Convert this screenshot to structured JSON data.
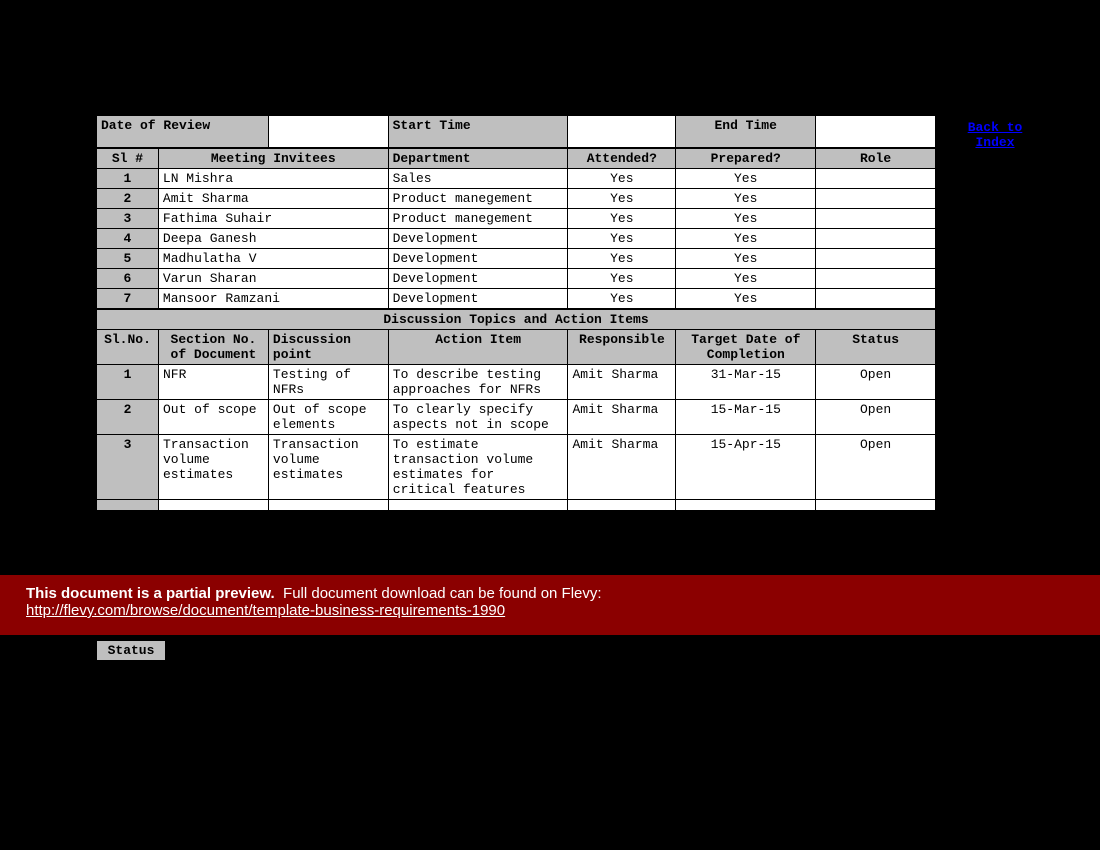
{
  "review": {
    "date_label": "Date of Review",
    "start_label": "Start Time",
    "end_label": "End Time"
  },
  "back_link": "Back to Index",
  "invitees_header": {
    "sl": "Sl #",
    "name": "Meeting Invitees",
    "dept": "Department",
    "attended": "Attended?",
    "prepared": "Prepared?",
    "role": "Role"
  },
  "invitees": [
    {
      "sl": "1",
      "name": "LN Mishra",
      "dept": "Sales",
      "attended": "Yes",
      "prepared": "Yes",
      "role": ""
    },
    {
      "sl": "2",
      "name": "Amit Sharma",
      "dept": "Product manegement",
      "attended": "Yes",
      "prepared": "Yes",
      "role": ""
    },
    {
      "sl": "3",
      "name": "Fathima Suhair",
      "dept": "Product manegement",
      "attended": "Yes",
      "prepared": "Yes",
      "role": ""
    },
    {
      "sl": "4",
      "name": "Deepa Ganesh",
      "dept": "Development",
      "attended": "Yes",
      "prepared": "Yes",
      "role": ""
    },
    {
      "sl": "5",
      "name": "Madhulatha V",
      "dept": "Development",
      "attended": "Yes",
      "prepared": "Yes",
      "role": ""
    },
    {
      "sl": "6",
      "name": "Varun Sharan",
      "dept": "Development",
      "attended": "Yes",
      "prepared": "Yes",
      "role": ""
    },
    {
      "sl": "7",
      "name": "Mansoor Ramzani",
      "dept": "Development",
      "attended": "Yes",
      "prepared": "Yes",
      "role": ""
    }
  ],
  "discussion_title": "Discussion Topics and Action Items",
  "discussion_header": {
    "sl": "Sl.No.",
    "section": "Section No. of Document",
    "point": "Discussion point",
    "action": "Action Item",
    "responsible": "Responsible",
    "target": "Target Date of Completion",
    "status": "Status"
  },
  "discussion": [
    {
      "sl": "1",
      "section": "NFR",
      "point": "Testing of NFRs",
      "action": "To describe testing approaches for NFRs",
      "responsible": "Amit Sharma",
      "target": "31-Mar-15",
      "status": "Open"
    },
    {
      "sl": "2",
      "section": "Out of scope",
      "point": "Out of scope elements",
      "action": "To clearly specify aspects not in scope",
      "responsible": "Amit Sharma",
      "target": "15-Mar-15",
      "status": "Open"
    },
    {
      "sl": "3",
      "section": "Transaction volume estimates",
      "point": "Transaction volume estimates",
      "action": "To estimate transaction volume estimates for critical features",
      "responsible": "Amit Sharma",
      "target": "15-Apr-15",
      "status": "Open"
    }
  ],
  "status_label": "Status",
  "banner": {
    "bold": "This document is a partial preview.",
    "rest": "Full document download can be found on Flevy:",
    "url": "http://flevy.com/browse/document/template-business-requirements-1990"
  }
}
